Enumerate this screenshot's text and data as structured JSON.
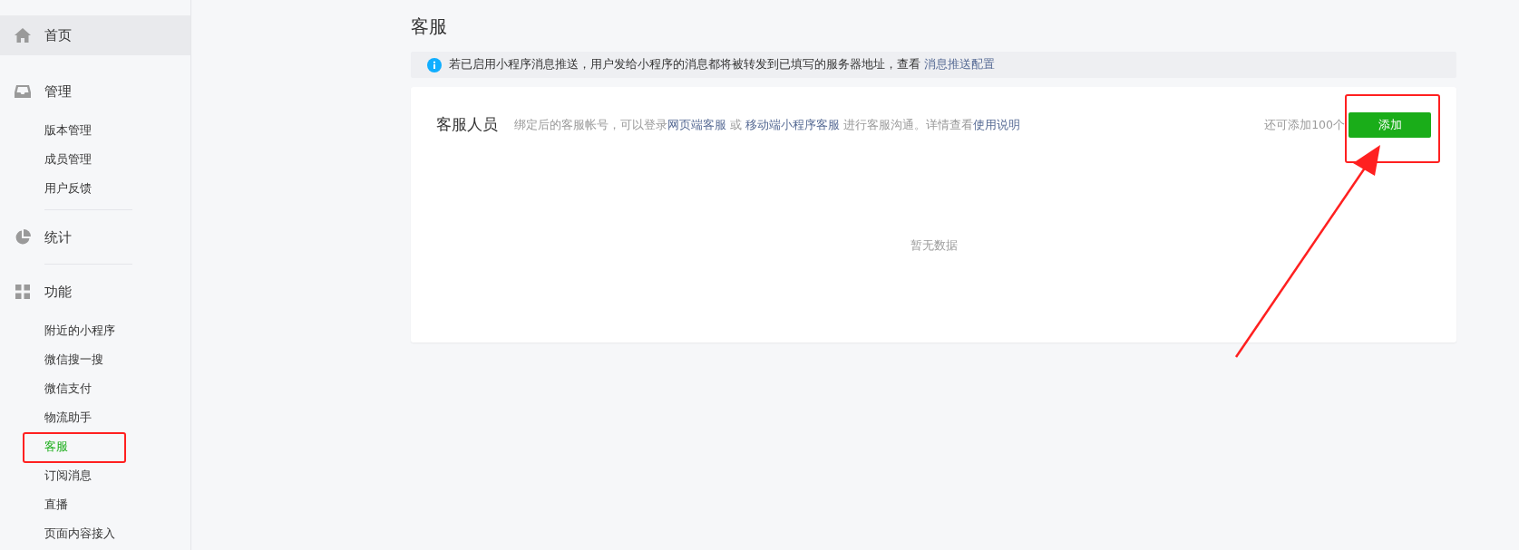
{
  "sidebar": {
    "sections": [
      {
        "title": "首页",
        "highlighted": true
      },
      {
        "title": "管理",
        "highlighted": false,
        "children": [
          {
            "label": "版本管理",
            "selected": false
          },
          {
            "label": "成员管理",
            "selected": false
          },
          {
            "label": "用户反馈",
            "selected": false
          }
        ]
      },
      {
        "title": "统计",
        "highlighted": false
      },
      {
        "title": "功能",
        "highlighted": false,
        "children": [
          {
            "label": "附近的小程序",
            "selected": false
          },
          {
            "label": "微信搜一搜",
            "selected": false
          },
          {
            "label": "微信支付",
            "selected": false
          },
          {
            "label": "物流助手",
            "selected": false
          },
          {
            "label": "客服",
            "selected": true
          },
          {
            "label": "订阅消息",
            "selected": false
          },
          {
            "label": "直播",
            "selected": false
          },
          {
            "label": "页面内容接入",
            "selected": false
          }
        ]
      }
    ]
  },
  "page": {
    "title": "客服",
    "notice": {
      "text": "若已启用小程序消息推送，用户发给小程序的消息都将被转发到已填写的服务器地址，查看",
      "link": "消息推送配置"
    },
    "card": {
      "title": "客服人员",
      "description": [
        {
          "kind": "text",
          "text": "绑定后的客服帐号，可以登录"
        },
        {
          "kind": "link",
          "text": "网页端客服"
        },
        {
          "kind": "text",
          "text": " 或 "
        },
        {
          "kind": "link",
          "text": "移动端小程序客服"
        },
        {
          "kind": "text",
          "text": " 进行客服沟通。详情查看"
        },
        {
          "kind": "link",
          "text": "使用说明"
        }
      ],
      "remaining": "还可添加100个",
      "add_button": "添加",
      "empty": "暂无数据"
    }
  }
}
